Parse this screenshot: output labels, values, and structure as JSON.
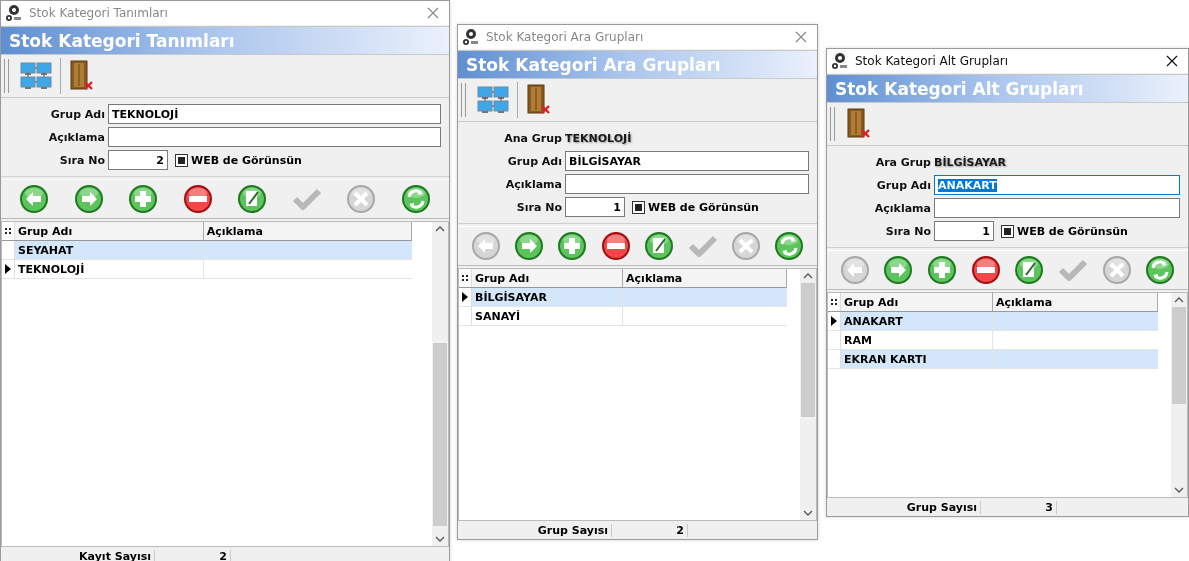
{
  "windows": [
    {
      "title": "Stok Kategori Tanımları",
      "active": false,
      "header": "Stok Kategori Tanımları",
      "toolbar": [
        {
          "kind": "network"
        },
        {
          "kind": "exit"
        }
      ],
      "fields": {
        "name_label": "Grup Adı",
        "name_value": "TEKNOLOJİ",
        "name_focused": false,
        "description_label": "Açıklama",
        "order_label": "Sıra No",
        "order_value": "2",
        "web_label": "WEB de Görünsün",
        "web_checked": true
      },
      "nav": [
        {
          "kind": "prev",
          "disabled": false
        },
        {
          "kind": "next",
          "disabled": false
        },
        {
          "kind": "add",
          "disabled": false
        },
        {
          "kind": "delete",
          "disabled": false
        },
        {
          "kind": "edit",
          "disabled": false
        },
        {
          "kind": "confirm",
          "disabled": true
        },
        {
          "kind": "cancel",
          "disabled": true
        },
        {
          "kind": "refresh",
          "disabled": false
        }
      ],
      "table": {
        "columns": [
          "Grup Adı",
          "Açıklama"
        ],
        "rows": [
          {
            "name": "SEYAHAT",
            "current": false
          },
          {
            "name": "TEKNOLOJİ",
            "current": true
          }
        ]
      },
      "footer": {
        "label": "Kayıt Sayısı",
        "value": "2"
      }
    },
    {
      "title": "Stok Kategori Ara Grupları",
      "active": false,
      "header": "Stok Kategori Ara Grupları",
      "toolbar": [
        {
          "kind": "network"
        },
        {
          "kind": "exit"
        }
      ],
      "parent": {
        "label": "Ana Grup",
        "value": "TEKNOLOJİ"
      },
      "fields": {
        "name_label": "Grup Adı",
        "name_value": "BİLGİSAYAR",
        "name_focused": false,
        "description_label": "Açıklama",
        "order_label": "Sıra No",
        "order_value": "1",
        "web_label": "WEB de Görünsün",
        "web_checked": true
      },
      "nav": [
        {
          "kind": "prev",
          "disabled": true
        },
        {
          "kind": "next",
          "disabled": false
        },
        {
          "kind": "add",
          "disabled": false
        },
        {
          "kind": "delete",
          "disabled": false
        },
        {
          "kind": "edit",
          "disabled": false
        },
        {
          "kind": "confirm",
          "disabled": true
        },
        {
          "kind": "cancel",
          "disabled": true
        },
        {
          "kind": "refresh",
          "disabled": false
        }
      ],
      "table": {
        "columns": [
          "Grup Adı",
          "Açıklama"
        ],
        "rows": [
          {
            "name": "BİLGİSAYAR",
            "current": true
          },
          {
            "name": "SANAYİ",
            "current": false
          }
        ]
      },
      "footer": {
        "label": "Grup Sayısı",
        "value": "2"
      }
    },
    {
      "title": "Stok Kategori Alt Grupları",
      "active": true,
      "header": "Stok Kategori Alt Grupları",
      "toolbar": [
        {
          "kind": "exit"
        }
      ],
      "parent": {
        "label": "Ara Grup",
        "value": "BİLGİSAYAR"
      },
      "fields": {
        "name_label": "Grup Adı",
        "name_value": "ANAKART",
        "name_focused": true,
        "description_label": "Açıklama",
        "order_label": "Sıra No",
        "order_value": "1",
        "web_label": "WEB de Görünsün",
        "web_checked": true
      },
      "nav": [
        {
          "kind": "prev",
          "disabled": true
        },
        {
          "kind": "next",
          "disabled": false
        },
        {
          "kind": "add",
          "disabled": false
        },
        {
          "kind": "delete",
          "disabled": false
        },
        {
          "kind": "edit",
          "disabled": false
        },
        {
          "kind": "confirm",
          "disabled": true
        },
        {
          "kind": "cancel",
          "disabled": true
        },
        {
          "kind": "refresh",
          "disabled": false
        }
      ],
      "table": {
        "columns": [
          "Grup Adı",
          "Açıklama"
        ],
        "rows": [
          {
            "name": "ANAKART",
            "current": true
          },
          {
            "name": "RAM",
            "current": false
          },
          {
            "name": "EKRAN KARTI",
            "current": false
          }
        ]
      },
      "footer": {
        "label": "Grup Sayısı",
        "value": "3"
      }
    }
  ]
}
